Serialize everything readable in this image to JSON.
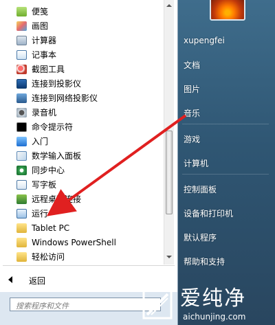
{
  "programs": [
    {
      "label": "便笺",
      "icon": "sticky-notes-icon"
    },
    {
      "label": "画图",
      "icon": "paint-icon"
    },
    {
      "label": "计算器",
      "icon": "calculator-icon"
    },
    {
      "label": "记事本",
      "icon": "notepad-icon"
    },
    {
      "label": "截图工具",
      "icon": "snipping-tool-icon"
    },
    {
      "label": "连接到投影仪",
      "icon": "projector-icon"
    },
    {
      "label": "连接到网络投影仪",
      "icon": "network-projector-icon"
    },
    {
      "label": "录音机",
      "icon": "sound-recorder-icon"
    },
    {
      "label": "命令提示符",
      "icon": "command-prompt-icon"
    },
    {
      "label": "入门",
      "icon": "getting-started-icon"
    },
    {
      "label": "数学输入面板",
      "icon": "math-input-panel-icon"
    },
    {
      "label": "同步中心",
      "icon": "sync-center-icon"
    },
    {
      "label": "写字板",
      "icon": "wordpad-icon"
    },
    {
      "label": "远程桌面连接",
      "icon": "remote-desktop-icon"
    },
    {
      "label": "运行",
      "icon": "run-icon"
    },
    {
      "label": "Tablet PC",
      "icon": "folder-icon"
    },
    {
      "label": "Windows PowerShell",
      "icon": "folder-icon"
    },
    {
      "label": "轻松访问",
      "icon": "folder-icon"
    }
  ],
  "back_label": "返回",
  "search": {
    "placeholder": "搜索程序和文件"
  },
  "right_menu": {
    "user": "xupengfei",
    "items": [
      "文档",
      "图片",
      "音乐",
      "游戏",
      "计算机",
      "控制面板",
      "设备和打印机",
      "默认程序",
      "帮助和支持"
    ]
  },
  "watermark": {
    "brand": "爱纯净",
    "url": "aichunjing.com"
  },
  "colors": {
    "arrow": "#e02020"
  }
}
